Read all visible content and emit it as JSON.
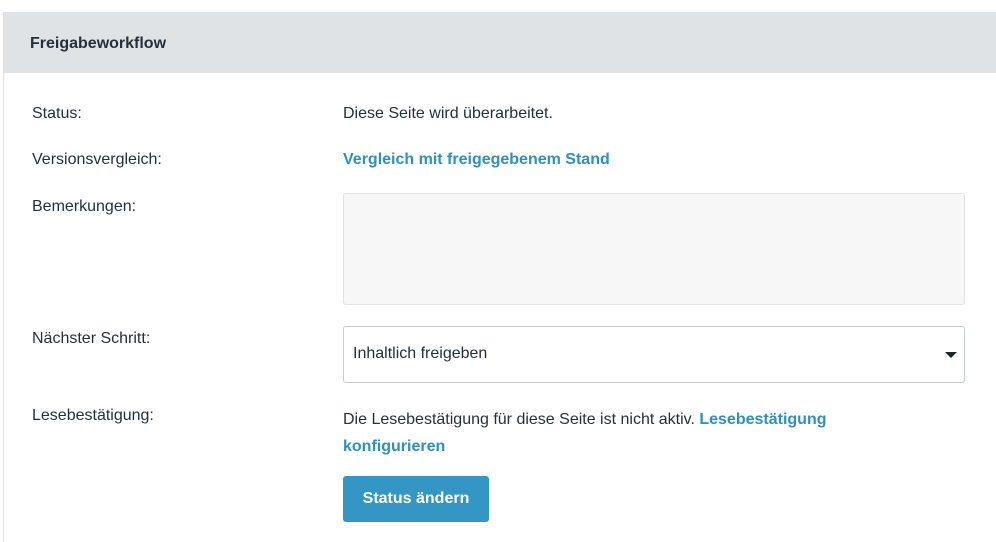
{
  "panel": {
    "title": "Freigabeworkflow"
  },
  "rows": {
    "status_label": "Status:",
    "status_value": "Diese Seite wird überarbeitet.",
    "version_label": "Versionsvergleich:",
    "version_link": "Vergleich mit freigegebenem Stand",
    "remarks_label": "Bemerkungen:",
    "remarks_value": "",
    "next_step_label": "Nächster Schritt:",
    "next_step_selected": "Inhaltlich freigeben",
    "read_conf_label": "Lesebestätigung:",
    "read_conf_text": "Die Lesebestätigung für diese Seite ist nicht aktiv.",
    "read_conf_link": "Lesebestätigung konfigurieren"
  },
  "actions": {
    "submit_label": "Status ändern"
  },
  "colors": {
    "header_bg": "#dfe3e6",
    "link": "#2f8fbf",
    "button_bg": "#3396c4"
  },
  "icons": {
    "select_caret": "caret-down-icon"
  }
}
